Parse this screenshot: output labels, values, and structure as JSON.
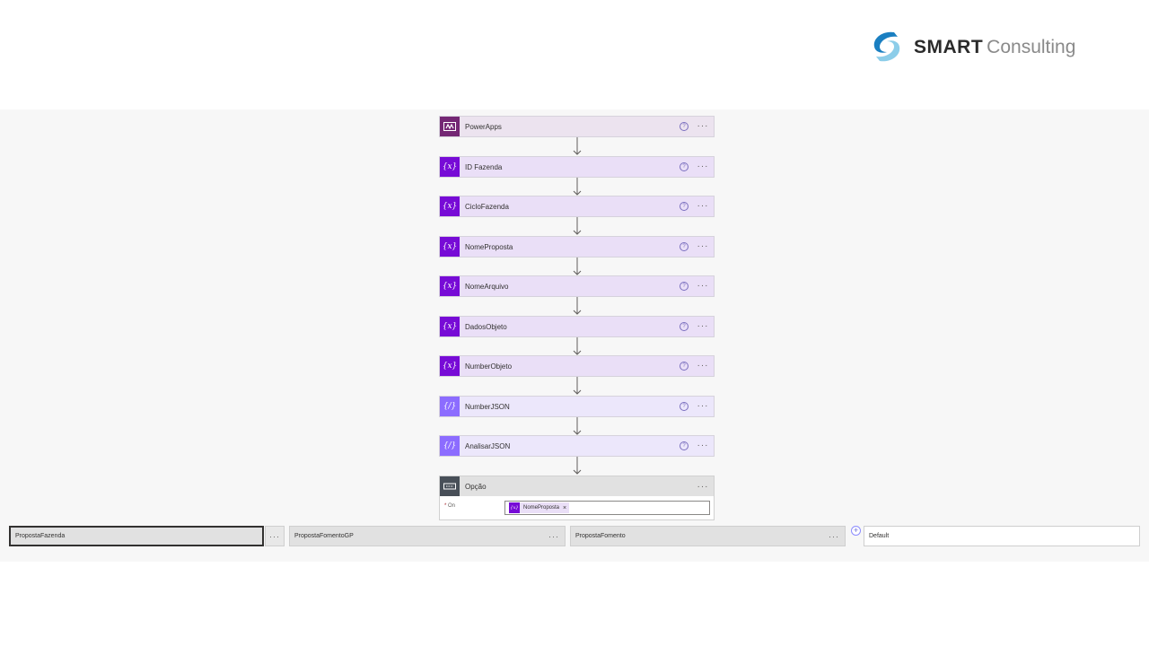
{
  "logo": {
    "brand": "SMART",
    "sub": "Consulting",
    "icon": "smart-swirl-logo",
    "colors": {
      "swirl_dark": "#1a7fc1",
      "swirl_light": "#8ccde9",
      "brand_text": "#2b2b2b",
      "sub_text": "#8a8a8a"
    }
  },
  "flow": {
    "steps": [
      {
        "label": "PowerApps",
        "kind": "trigger",
        "icon": "powerapps-icon"
      },
      {
        "label": "ID Fazenda",
        "kind": "variable",
        "icon": "variable-icon"
      },
      {
        "label": "CicloFazenda",
        "kind": "variable",
        "icon": "variable-icon"
      },
      {
        "label": "NomeProposta",
        "kind": "variable",
        "icon": "variable-icon"
      },
      {
        "label": "NomeArquivo",
        "kind": "variable",
        "icon": "variable-icon"
      },
      {
        "label": "DadosObjeto",
        "kind": "variable",
        "icon": "variable-icon"
      },
      {
        "label": "NumberObjeto",
        "kind": "variable",
        "icon": "variable-icon"
      },
      {
        "label": "NumberJSON",
        "kind": "json",
        "icon": "data-operation-icon"
      },
      {
        "label": "AnalisarJSON",
        "kind": "json",
        "icon": "data-operation-icon"
      }
    ],
    "switch": {
      "label": "Opção",
      "on_label": "On",
      "on_token": "NomeProposta",
      "icon": "switch-icon"
    },
    "cases": [
      {
        "label": "PropostaFazenda",
        "selected": true
      },
      {
        "label": "PropostaFomentoGP",
        "selected": false
      },
      {
        "label": "PropostaFomento",
        "selected": false
      },
      {
        "label": "Default",
        "selected": false
      }
    ]
  },
  "colors": {
    "trigger": "#742774",
    "variable": "#770bd6",
    "json": "#8c6cff",
    "switch": "#484f58",
    "canvas": "#f7f7f7"
  }
}
